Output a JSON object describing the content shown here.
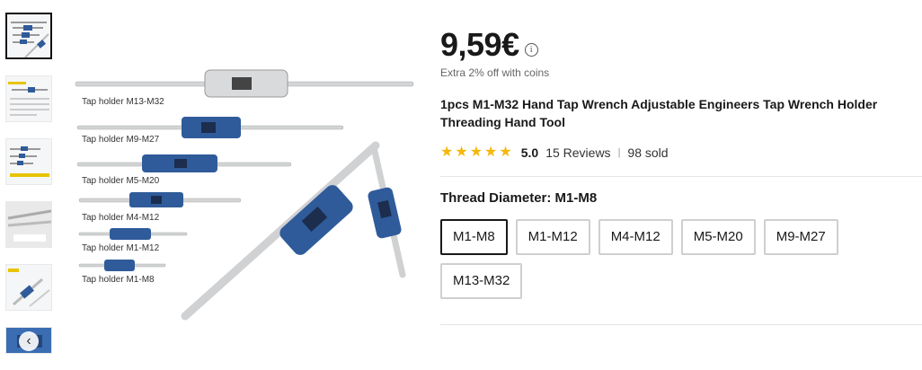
{
  "product": {
    "price": "9,59€",
    "coins_note": "Extra 2% off with coins",
    "title": "1pcs M1-M32 Hand Tap Wrench Adjustable Engineers Tap Wrench Holder Threading Hand Tool",
    "rating": {
      "stars": 5,
      "score": "5.0",
      "reviews": "15 Reviews",
      "separator": "|",
      "sold": "98 sold"
    }
  },
  "variant": {
    "label": "Thread Diameter: M1-M8",
    "options": [
      "M1-M8",
      "M1-M12",
      "M4-M12",
      "M5-M20",
      "M9-M27",
      "M13-M32"
    ],
    "selected": "M1-M8"
  },
  "image": {
    "labels": [
      "Tap holder  M13-M32",
      "Tap holder  M9-M27",
      "Tap holder  M5-M20",
      "Tap holder  M4-M12",
      "Tap holder  M1-M12",
      "Tap holder  M1-M8"
    ]
  },
  "icons": {
    "info": "info-icon",
    "star": "star-icon",
    "prev": "chevron-left-icon"
  },
  "colors": {
    "star": "#f4b70b",
    "wrench_blue": "#2f5b9a",
    "selected_border": "#191919"
  }
}
